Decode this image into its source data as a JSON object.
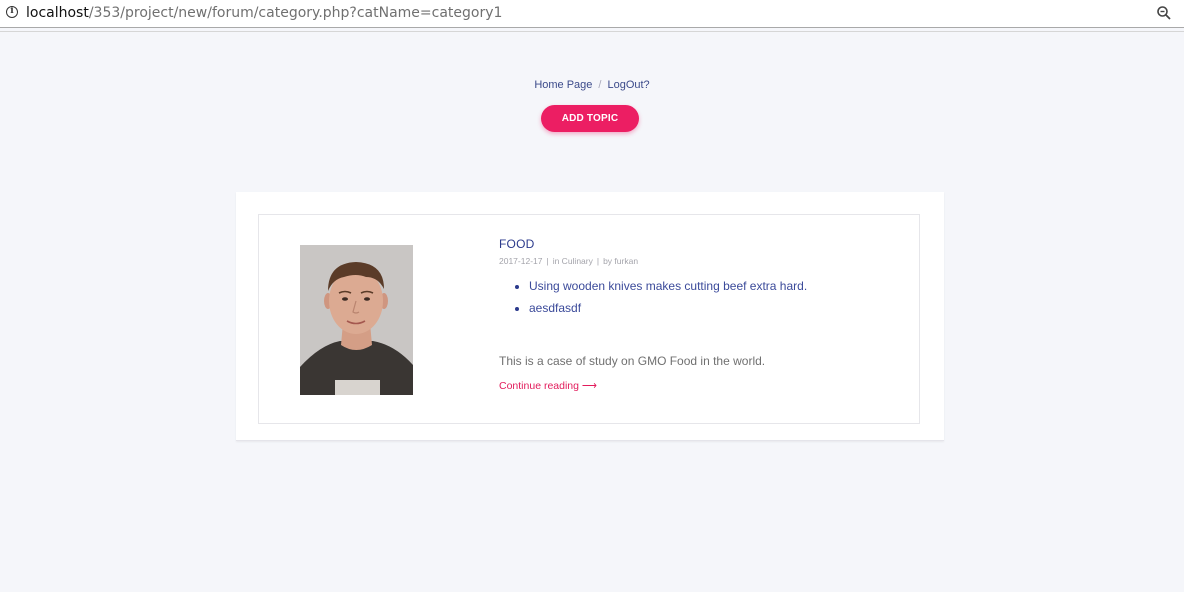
{
  "browser": {
    "url_host": "localhost",
    "url_path": "/353/project/new/forum/category.php?catName=category1",
    "info_icon": "info-icon",
    "zoom_icon": "zoom-icon"
  },
  "nav": {
    "home_label": "Home Page",
    "separator": "/",
    "logout_label": "LogOut?"
  },
  "actions": {
    "add_topic_label": "ADD TOPIC"
  },
  "post": {
    "title": "FOOD",
    "date": "2017-12-17",
    "category": "in Culinary",
    "author": "by furkan",
    "meta_separator": "|",
    "links": [
      "Using wooden knives makes cutting beef extra hard.",
      "aesdfasdf"
    ],
    "excerpt": "This is a case of study on GMO Food in the world.",
    "continue_label": "Continue reading ⟶"
  },
  "colors": {
    "accent": "#ec1e63",
    "link": "#2b3a8c",
    "background": "#f5f6fa"
  }
}
